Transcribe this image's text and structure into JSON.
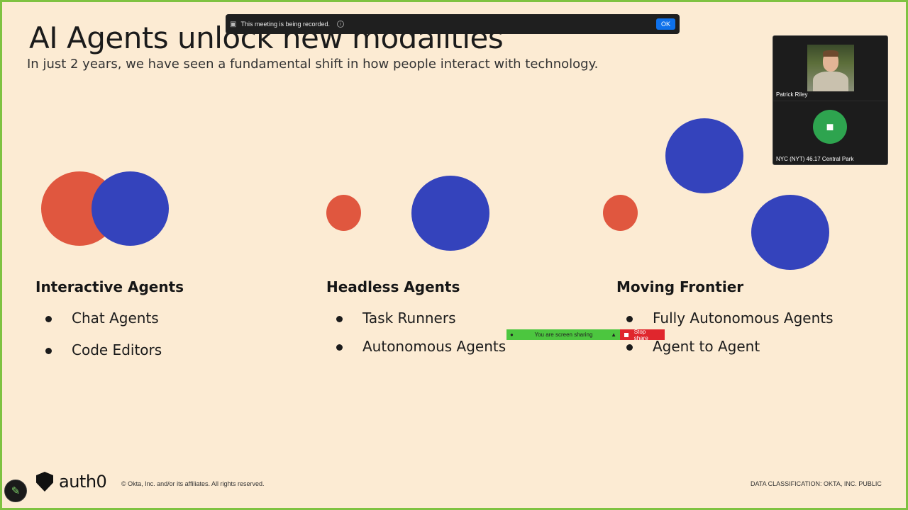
{
  "slide": {
    "title": "AI Agents unlock new modalities",
    "subtitle": "In just 2 years, we have seen a fundamental shift in how people interact with technology.",
    "columns": [
      {
        "heading": "Interactive Agents",
        "items": [
          "Chat Agents",
          "Code Editors"
        ]
      },
      {
        "heading": "Headless Agents",
        "items": [
          "Task Runners",
          "Autonomous Agents"
        ]
      },
      {
        "heading": "Moving Frontier",
        "items": [
          "Fully Autonomous Agents",
          "Agent to Agent"
        ]
      }
    ],
    "colors": {
      "background": "#fcebd3",
      "red": "#e0573f",
      "blue": "#3443bc"
    },
    "footer": {
      "brand": "auth0",
      "copyright": "© Okta, Inc. and/or its affiliates. All rights reserved.",
      "classification": "DATA CLASSIFICATION: OKTA, INC. PUBLIC"
    }
  },
  "recording_banner": {
    "message": "This meeting is being recorded.",
    "ok_label": "OK",
    "icon": "record-camera-icon"
  },
  "participants": [
    {
      "name": "Patrick Riley",
      "type": "video"
    },
    {
      "name": "NYC (NYT) 46.17 Central Park",
      "type": "room",
      "icon": "room-system-icon"
    }
  ],
  "share_bar": {
    "status": "You are screen sharing",
    "stop_label": "Stop share",
    "colors": {
      "sharing": "#4cc63f",
      "stop": "#e0262d"
    }
  },
  "annotate_button": {
    "icon": "pencil-icon"
  }
}
